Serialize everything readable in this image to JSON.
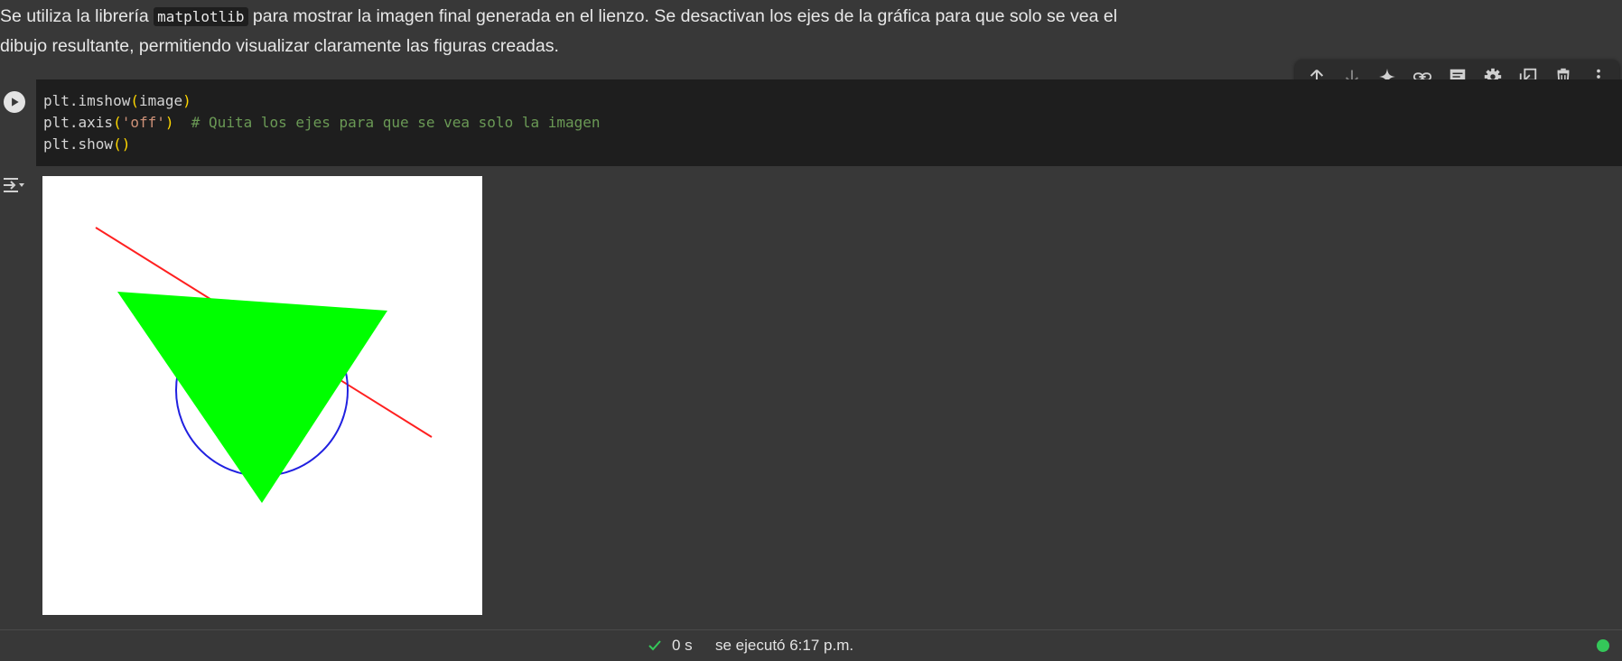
{
  "text_cell": {
    "before_code": "Se utiliza la librería ",
    "inline_code": "matplotlib",
    "after_code": " para mostrar la imagen final generada en el lienzo. Se desactivan los ejes de la gráfica para que solo se vea el dibujo resultante, permitiendo visualizar claramente las figuras creadas."
  },
  "toolbar": {
    "buttons": [
      "move-up-icon",
      "move-down-icon",
      "gemini-sparkle-icon",
      "link-icon",
      "comment-icon",
      "settings-gear-icon",
      "mirror-cell-icon",
      "delete-icon",
      "more-vert-icon"
    ]
  },
  "code_cell": {
    "line1": {
      "call": "plt.imshow",
      "open": "(",
      "arg": "image",
      "close": ")"
    },
    "line2": {
      "call": "plt.axis",
      "open": "(",
      "arg": "'off'",
      "close": ")",
      "comment": "  # Quita los ejes para que se vea solo la imagen"
    },
    "line3": {
      "call": "plt.show",
      "open": "(",
      "close": ")"
    }
  },
  "output": {
    "figure_colors": {
      "background": "#ffffff",
      "line": "#ff2020",
      "circle": "#2020e0",
      "triangle": "#00ff00"
    }
  },
  "status_bar": {
    "duration": "0 s",
    "executed": "se ejecutó 6:17 p.m."
  },
  "colors": {
    "background": "#383838",
    "editor_bg": "#1e1e1e",
    "comment": "#6a9955",
    "string": "#ce9178",
    "paren": "#ffd700",
    "status_ok": "#34c759"
  }
}
